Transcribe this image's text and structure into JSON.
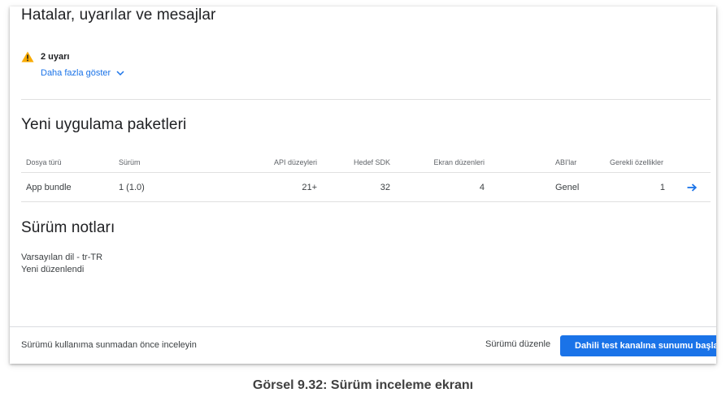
{
  "sections": {
    "errors_title": "Hatalar, uyarılar ve mesajlar",
    "warnings_label": "2 uyarı",
    "show_more_label": "Daha fazla göster",
    "packages_title": "Yeni uygulama paketleri",
    "notes_title": "Sürüm notları"
  },
  "table": {
    "headers": [
      "Dosya türü",
      "Sürüm",
      "API düzeyleri",
      "Hedef SDK",
      "Ekran düzenleri",
      "ABI'lar",
      "Gerekli özellikler"
    ],
    "rows": [
      [
        "App bundle",
        "1 (1.0)",
        "21+",
        "32",
        "4",
        "Genel",
        "1"
      ]
    ]
  },
  "notes": {
    "line1": "Varsayılan dil - tr-TR",
    "line2": "Yeni düzenlendi"
  },
  "footer": {
    "hint": "Sürümü kullanıma sunmadan önce inceleyin",
    "edit_label": "Sürümü düzenle",
    "primary_label": "Dahili test kanalına sunumu başlat"
  },
  "caption": "Görsel 9.32: Sürüm inceleme ekranı",
  "colors": {
    "accent": "#1a73e8",
    "warning": "#f9ab00"
  },
  "icons": {
    "warning": "warning-icon",
    "chevron": "chevron-down-icon",
    "arrow": "arrow-right-icon"
  }
}
